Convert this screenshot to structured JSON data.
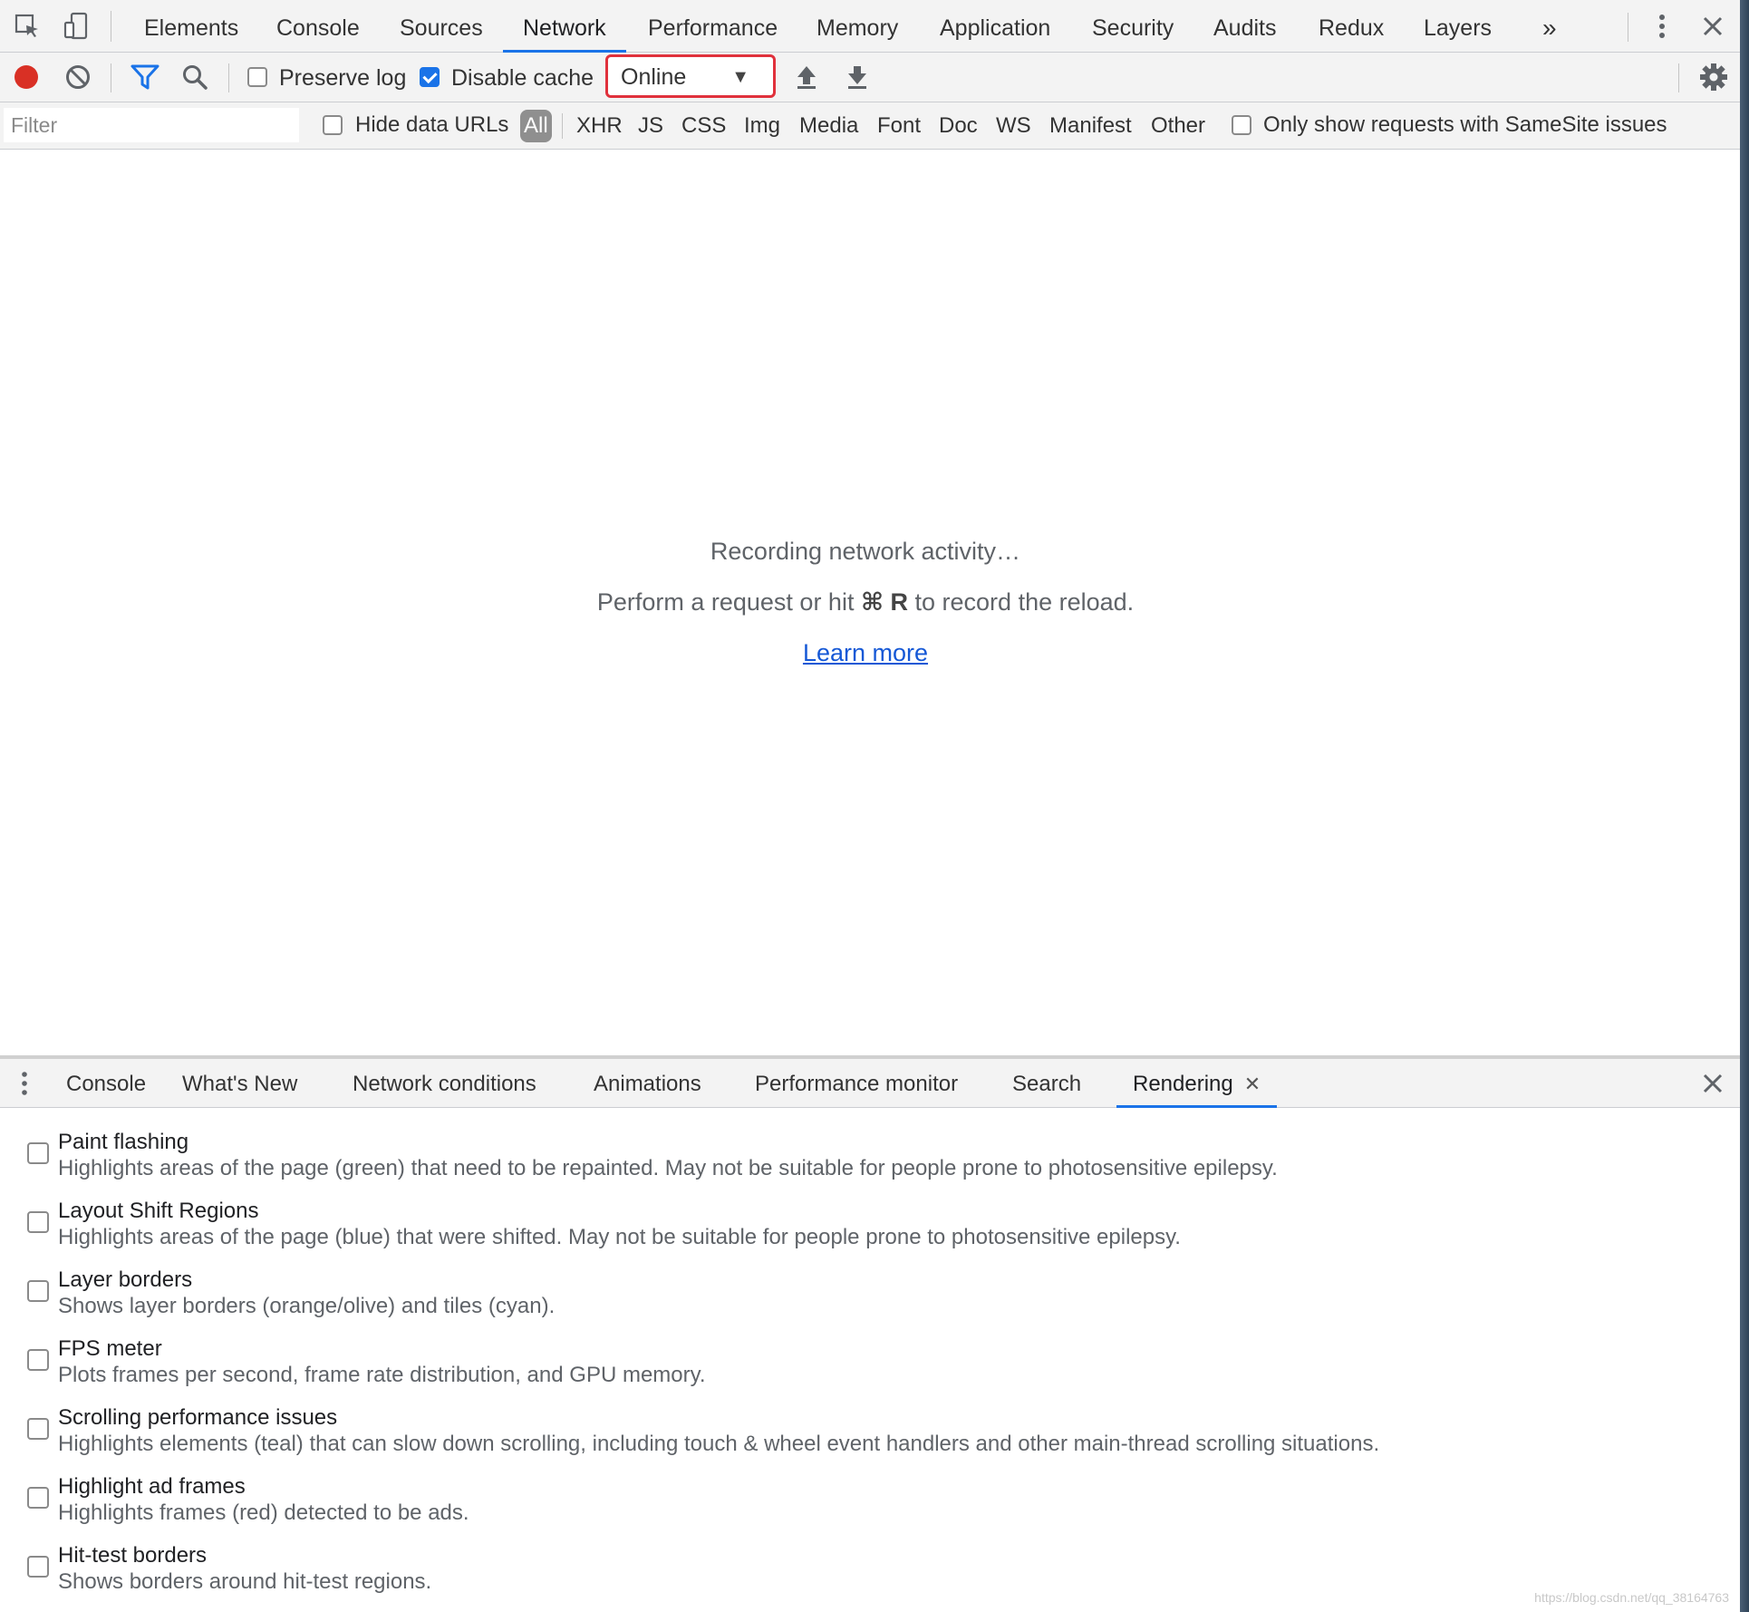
{
  "main_tabs": {
    "elements": "Elements",
    "console": "Console",
    "sources": "Sources",
    "network": "Network",
    "performance": "Performance",
    "memory": "Memory",
    "application": "Application",
    "security": "Security",
    "audits": "Audits",
    "redux": "Redux",
    "layers": "Layers",
    "more": "»"
  },
  "toolbar": {
    "preserve_log": "Preserve log",
    "disable_cache": "Disable cache",
    "throttling": "Online",
    "caret": "▼"
  },
  "filter": {
    "placeholder": "Filter",
    "hide_data_urls": "Hide data URLs",
    "types": {
      "all": "All",
      "xhr": "XHR",
      "js": "JS",
      "css": "CSS",
      "img": "Img",
      "media": "Media",
      "font": "Font",
      "doc": "Doc",
      "ws": "WS",
      "manifest": "Manifest",
      "other": "Other"
    },
    "samesite": "Only show requests with SameSite issues"
  },
  "empty_state": {
    "line1": "Recording network activity…",
    "line2_prefix": "Perform a request or hit ",
    "shortcut": "⌘ R",
    "line2_suffix": " to record the reload.",
    "learn_more": "Learn more"
  },
  "drawer": {
    "tabs": {
      "console": "Console",
      "whats_new": "What's New",
      "network_conditions": "Network conditions",
      "animations": "Animations",
      "performance_monitor": "Performance monitor",
      "search": "Search",
      "rendering": "Rendering"
    },
    "tab_close": "✕"
  },
  "rendering": [
    {
      "title": "Paint flashing",
      "desc": "Highlights areas of the page (green) that need to be repainted. May not be suitable for people prone to photosensitive epilepsy."
    },
    {
      "title": "Layout Shift Regions",
      "desc": "Highlights areas of the page (blue) that were shifted. May not be suitable for people prone to photosensitive epilepsy."
    },
    {
      "title": "Layer borders",
      "desc": "Shows layer borders (orange/olive) and tiles (cyan)."
    },
    {
      "title": "FPS meter",
      "desc": "Plots frames per second, frame rate distribution, and GPU memory."
    },
    {
      "title": "Scrolling performance issues",
      "desc": "Highlights elements (teal) that can slow down scrolling, including touch & wheel event handlers and other main-thread scrolling situations."
    },
    {
      "title": "Highlight ad frames",
      "desc": "Highlights frames (red) detected to be ads."
    },
    {
      "title": "Hit-test borders",
      "desc": "Shows borders around hit-test regions."
    }
  ],
  "watermark": "https://blog.csdn.net/qq_38164763",
  "colors": {
    "accent": "#1a73e8",
    "record": "#d93025",
    "highlight_box": "#e0313c",
    "link": "#1558d6"
  }
}
